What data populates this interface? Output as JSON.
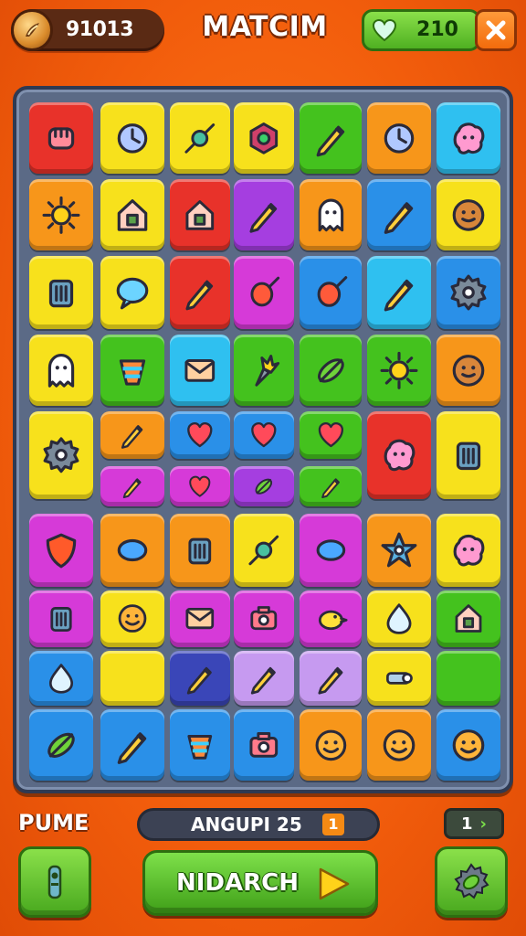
{
  "header": {
    "coins": "91013",
    "title": "MATCIM",
    "lives": "210"
  },
  "tile_colors": {
    "red": "#e8322a",
    "yellow": "#f7e11c",
    "orange": "#f7961a",
    "green": "#44c21e",
    "cyan": "#2fc0f0",
    "blue": "#2a90e8",
    "purple": "#a53ee0",
    "magenta": "#d63ad8",
    "lavender": "#c69af0",
    "navy": "#3a46b8"
  },
  "board": {
    "rows": [
      [
        {
          "color": "red",
          "icon": "fist-icon"
        },
        {
          "color": "yellow",
          "icon": "clock-icon"
        },
        {
          "color": "yellow",
          "icon": "candy-icon"
        },
        {
          "color": "yellow",
          "icon": "gem-box-icon"
        },
        {
          "color": "green",
          "icon": "paintbrush-icon"
        },
        {
          "color": "orange",
          "icon": "planet-icon"
        },
        {
          "color": "cyan",
          "icon": "octopus-icon"
        }
      ],
      [
        {
          "color": "orange",
          "icon": "sun-icon"
        },
        {
          "color": "yellow",
          "icon": "house-face-icon"
        },
        {
          "color": "red",
          "icon": "birdhouse-icon"
        },
        {
          "color": "purple",
          "icon": "brush-icon"
        },
        {
          "color": "orange",
          "icon": "ghost-icon"
        },
        {
          "color": "blue",
          "icon": "pencil-icon"
        },
        {
          "color": "yellow",
          "icon": "cookie-icon"
        }
      ],
      [
        {
          "color": "yellow",
          "icon": "jar-icon"
        },
        {
          "color": "yellow",
          "icon": "speech-bubble-icon"
        },
        {
          "color": "red",
          "icon": "pencil-icon"
        },
        {
          "color": "magenta",
          "icon": "potion-icon"
        },
        {
          "color": "blue",
          "icon": "balloon-icon"
        },
        {
          "color": "cyan",
          "icon": "pencil-icon"
        },
        {
          "color": "blue",
          "icon": "gear-icon"
        }
      ],
      [
        {
          "color": "yellow",
          "icon": "ghost-icon"
        },
        {
          "color": "green",
          "icon": "spinning-top-icon"
        },
        {
          "color": "cyan",
          "icon": "envelope-icon"
        },
        {
          "color": "green",
          "icon": "torch-icon"
        },
        {
          "color": "green",
          "icon": "pickle-icon"
        },
        {
          "color": "green",
          "icon": "sun-icon"
        },
        {
          "color": "orange",
          "icon": "cookie-icon"
        }
      ],
      [
        {
          "color": "yellow",
          "icon": "gear-icon"
        },
        {
          "color": "orange",
          "icon": "brush-icon"
        },
        {
          "color": "blue",
          "icon": "heart-icon"
        },
        {
          "color": "blue",
          "icon": "heart-icon"
        },
        {
          "color": "green",
          "icon": "heart-icon"
        },
        {
          "color": "red",
          "icon": "blob-icon"
        },
        {
          "color": "yellow",
          "icon": "speaker-icon"
        }
      ],
      [
        {
          "color": "magenta",
          "icon": "shield-icon"
        },
        {
          "color": "orange",
          "icon": "pill-icon"
        },
        {
          "color": "orange",
          "icon": "trash-icon"
        },
        {
          "color": "yellow",
          "icon": "candy-icon"
        },
        {
          "color": "magenta",
          "icon": "candy-wrap-icon"
        },
        {
          "color": "orange",
          "icon": "star-eye-icon"
        },
        {
          "color": "yellow",
          "icon": "splat-icon"
        }
      ],
      [
        {
          "color": "magenta",
          "icon": "radio-icon"
        },
        {
          "color": "yellow",
          "icon": "smiley-icon"
        },
        {
          "color": "magenta",
          "icon": "card-icon"
        },
        {
          "color": "magenta",
          "icon": "robot-icon"
        },
        {
          "color": "magenta",
          "icon": "bird-icon"
        },
        {
          "color": "yellow",
          "icon": "drop-icon"
        },
        {
          "color": "green",
          "icon": "lantern-icon"
        }
      ],
      [
        {
          "color": "blue",
          "icon": "shell-icon"
        },
        {
          "color": "yellow",
          "icon": "empty"
        },
        {
          "color": "navy",
          "icon": "pencil-icon"
        },
        {
          "color": "lavender",
          "icon": "pencil-icon"
        },
        {
          "color": "lavender",
          "icon": "pencil-icon"
        },
        {
          "color": "yellow",
          "icon": "key-icon"
        },
        {
          "color": "green",
          "icon": "empty"
        }
      ],
      [
        {
          "color": "blue",
          "icon": "leaf-icon"
        },
        {
          "color": "blue",
          "icon": "marker-icon"
        },
        {
          "color": "blue",
          "icon": "bucket-icon"
        },
        {
          "color": "blue",
          "icon": "camera-icon"
        },
        {
          "color": "orange",
          "icon": "smiley-icon"
        },
        {
          "color": "orange",
          "icon": "smiley-icon"
        },
        {
          "color": "blue",
          "icon": "smiley-icon"
        }
      ]
    ],
    "small_tiles": [
      {
        "color": "magenta",
        "icon": "wand-icon"
      },
      {
        "color": "magenta",
        "icon": "heart-icon"
      },
      {
        "color": "purple",
        "icon": "leaf-icon"
      },
      {
        "color": "green",
        "icon": "wand-icon"
      }
    ]
  },
  "footer": {
    "left_label": "PUME",
    "progress_label": "ANGUPI 25",
    "progress_badge": "1",
    "page_indicator": "1",
    "main_button_label": "NIDARCH"
  }
}
